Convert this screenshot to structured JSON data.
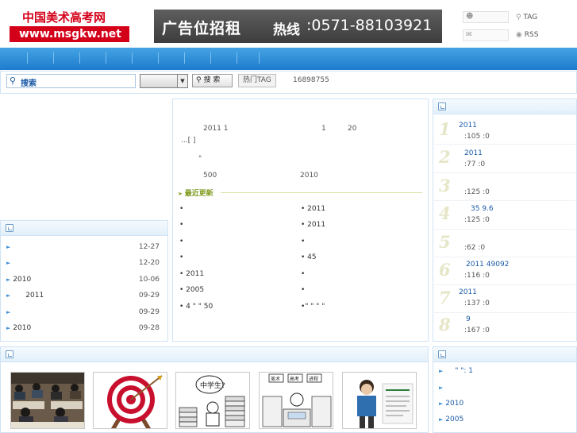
{
  "header": {
    "logo_line1": "中国美术高考网",
    "logo_line2": "www.msgkw.net",
    "ad_text": "广告位招租",
    "ad_hotline_label": "热线",
    "ad_phone": ":0571-88103921",
    "tag_label": "TAG",
    "rss_label": "RSS"
  },
  "search": {
    "input_label": "搜索",
    "button_label": "搜 索",
    "hot_tag_label": "热门TAG",
    "hot_count": "16898755"
  },
  "left_list": {
    "items": [
      {
        "title": "",
        "date": "12-27"
      },
      {
        "title": "",
        "date": "12-20"
      },
      {
        "title": "2010",
        "date": "10-06"
      },
      {
        "title": "2011",
        "date": "09-29"
      },
      {
        "title": "",
        "date": "09-29"
      },
      {
        "title": "2010",
        "date": "09-28"
      }
    ]
  },
  "center": {
    "headline_a": "2011  1",
    "headline_b": "1",
    "headline_c": "20",
    "more": "...[  ]",
    "quote": "\"",
    "stat_a": "500",
    "stat_b": "2010",
    "latest_label": "最近更新",
    "news_left": [
      "•",
      "•",
      "•",
      "•",
      "• 2011",
      "•              2005",
      "•   4   \"     \"   50"
    ],
    "news_right": [
      "• 2011",
      "•   2011",
      "•",
      "•    45",
      "•",
      "•",
      "•\"   \"  \"   \""
    ]
  },
  "ranking": {
    "items": [
      {
        "num": "1",
        "title": "2011",
        "meta": ":105    :0"
      },
      {
        "num": "2",
        "title": "2011",
        "meta": ":77    :0"
      },
      {
        "num": "3",
        "title": "",
        "meta": ":125    :0"
      },
      {
        "num": "4",
        "title": "35            9.6",
        "meta": ":125    :0"
      },
      {
        "num": "5",
        "title": "",
        "meta": ":62    :0"
      },
      {
        "num": "6",
        "title": "2011      49092",
        "meta": ":116    :0"
      },
      {
        "num": "7",
        "title": "2011",
        "meta": ":137    :0"
      },
      {
        "num": "8",
        "title": "9",
        "meta": ":167    :0"
      }
    ]
  },
  "right_list2": {
    "items": [
      "\"  \":        1",
      "",
      "2010",
      "2005"
    ]
  },
  "thumb_texts": {
    "t3_bubble": "中学生?",
    "t4_tag1": "美术",
    "t4_tag2": "高考",
    "t4_tag3": "进程"
  },
  "colors": {
    "nav_blue": "#1d7ccc",
    "brand_red": "#d4001a",
    "link_blue": "#1a5aa6"
  }
}
